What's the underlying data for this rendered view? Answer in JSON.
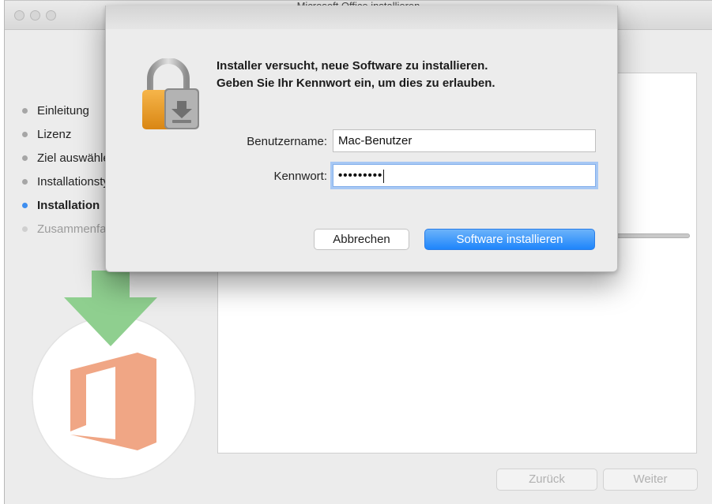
{
  "window": {
    "title": "Microsoft Office installieren",
    "steps": [
      {
        "label": "Einleitung",
        "state": "done"
      },
      {
        "label": "Lizenz",
        "state": "done"
      },
      {
        "label": "Ziel auswählen",
        "state": "done"
      },
      {
        "label": "Installationstyp",
        "state": "done"
      },
      {
        "label": "Installation",
        "state": "active"
      },
      {
        "label": "Zusammenfassung",
        "state": "future"
      }
    ],
    "back_label": "Zurück",
    "next_label": "Weiter"
  },
  "dialog": {
    "message_line1": "Installer versucht, neue Software zu installieren.",
    "message_line2": "Geben Sie Ihr Kennwort ein, um dies zu erlauben.",
    "username_label": "Benutzername:",
    "username_value": "Mac-Benutzer",
    "password_label": "Kennwort:",
    "password_value": "•••••••••",
    "cancel_label": "Abbrechen",
    "confirm_label": "Software installieren"
  },
  "colors": {
    "accent_blue": "#1e85fb",
    "focus_ring": "#a7c8f4",
    "office_orange": "#f0a685",
    "arrow_green": "#8fcf8f"
  },
  "icons": {
    "dialog": "padlock-icon",
    "product": "office-logo-icon"
  }
}
